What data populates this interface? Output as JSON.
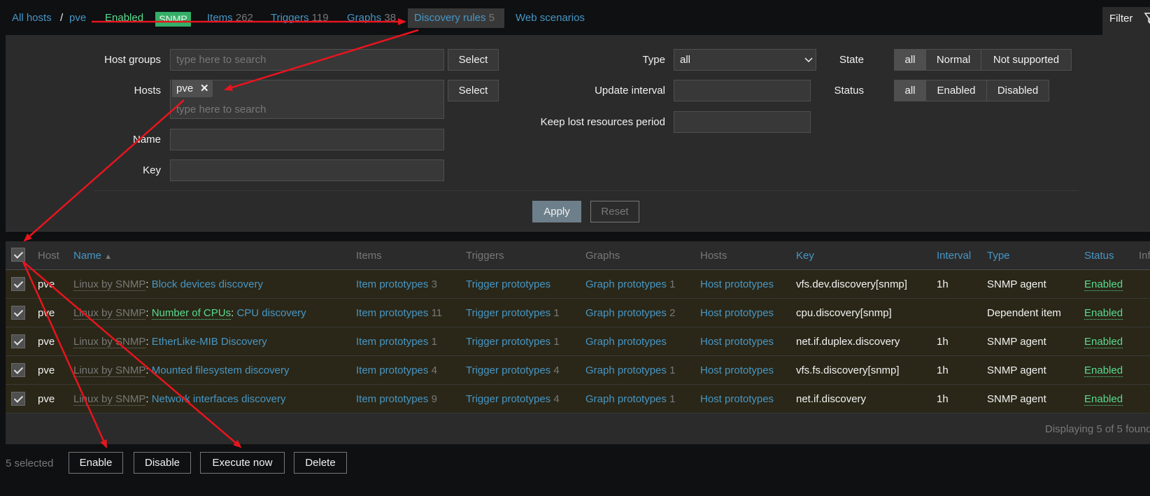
{
  "nav": {
    "all_hosts": "All hosts",
    "separator": "/",
    "host": "pve",
    "enabled": "Enabled",
    "snmp": "SNMP",
    "items": "Items",
    "items_count": "262",
    "triggers": "Triggers",
    "triggers_count": "119",
    "graphs": "Graphs",
    "graphs_count": "38",
    "discovery": "Discovery rules",
    "discovery_count": "5",
    "web": "Web scenarios",
    "filter": "Filter"
  },
  "filter": {
    "host_groups_label": "Host groups",
    "host_groups_placeholder": "type here to search",
    "select": "Select",
    "hosts_label": "Hosts",
    "hosts_tag": "pve",
    "hosts_placeholder": "type here to search",
    "name_label": "Name",
    "key_label": "Key",
    "type_label": "Type",
    "type_value": "all",
    "update_interval_label": "Update interval",
    "keep_lost_label": "Keep lost resources period",
    "state_label": "State",
    "state_options": [
      "all",
      "Normal",
      "Not supported"
    ],
    "status_label": "Status",
    "status_options": [
      "all",
      "Enabled",
      "Disabled"
    ],
    "apply": "Apply",
    "reset": "Reset"
  },
  "table": {
    "headers": {
      "host": "Host",
      "name": "Name",
      "items": "Items",
      "triggers": "Triggers",
      "graphs": "Graphs",
      "hosts": "Hosts",
      "key": "Key",
      "interval": "Interval",
      "type": "Type",
      "status": "Status",
      "info": "Info"
    },
    "rows": [
      {
        "host": "pve",
        "template": "Linux by SNMP",
        "parent": "",
        "name": "Block devices discovery",
        "items": "Item prototypes",
        "items_n": "3",
        "triggers": "Trigger prototypes",
        "triggers_n": "",
        "graphs": "Graph prototypes",
        "graphs_n": "1",
        "hosts": "Host prototypes",
        "key": "vfs.dev.discovery[snmp]",
        "interval": "1h",
        "type": "SNMP agent",
        "status": "Enabled"
      },
      {
        "host": "pve",
        "template": "Linux by SNMP",
        "parent": "Number of CPUs",
        "name": "CPU discovery",
        "items": "Item prototypes",
        "items_n": "11",
        "triggers": "Trigger prototypes",
        "triggers_n": "1",
        "graphs": "Graph prototypes",
        "graphs_n": "2",
        "hosts": "Host prototypes",
        "key": "cpu.discovery[snmp]",
        "interval": "",
        "type": "Dependent item",
        "status": "Enabled"
      },
      {
        "host": "pve",
        "template": "Linux by SNMP",
        "parent": "",
        "name": "EtherLike-MIB Discovery",
        "items": "Item prototypes",
        "items_n": "1",
        "triggers": "Trigger prototypes",
        "triggers_n": "1",
        "graphs": "Graph prototypes",
        "graphs_n": "",
        "hosts": "Host prototypes",
        "key": "net.if.duplex.discovery",
        "interval": "1h",
        "type": "SNMP agent",
        "status": "Enabled"
      },
      {
        "host": "pve",
        "template": "Linux by SNMP",
        "parent": "",
        "name": "Mounted filesystem discovery",
        "items": "Item prototypes",
        "items_n": "4",
        "triggers": "Trigger prototypes",
        "triggers_n": "4",
        "graphs": "Graph prototypes",
        "graphs_n": "1",
        "hosts": "Host prototypes",
        "key": "vfs.fs.discovery[snmp]",
        "interval": "1h",
        "type": "SNMP agent",
        "status": "Enabled"
      },
      {
        "host": "pve",
        "template": "Linux by SNMP",
        "parent": "",
        "name": "Network interfaces discovery",
        "items": "Item prototypes",
        "items_n": "9",
        "triggers": "Trigger prototypes",
        "triggers_n": "4",
        "graphs": "Graph prototypes",
        "graphs_n": "1",
        "hosts": "Host prototypes",
        "key": "net.if.discovery",
        "interval": "1h",
        "type": "SNMP agent",
        "status": "Enabled"
      }
    ],
    "displaying": "Displaying 5 of 5 found"
  },
  "footer": {
    "selected": "5 selected",
    "enable": "Enable",
    "disable": "Disable",
    "execute": "Execute now",
    "delete": "Delete"
  },
  "colors": {
    "link": "#4796c4",
    "enabled": "#59db8f",
    "annotation_arrow": "#e8141e"
  }
}
